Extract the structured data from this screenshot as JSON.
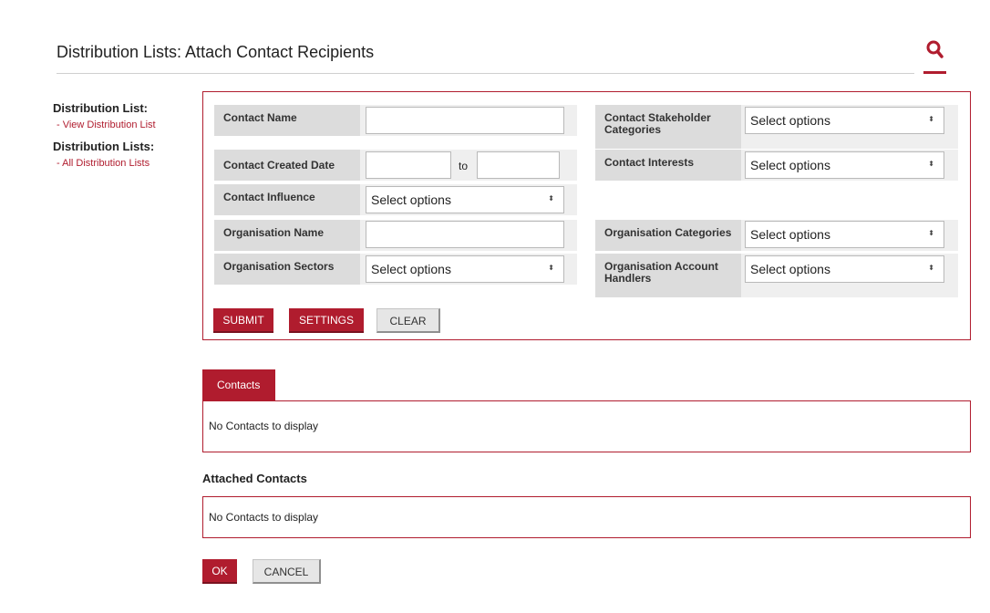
{
  "header": {
    "title": "Distribution Lists: Attach Contact Recipients",
    "search_icon": "search-icon",
    "accent_color": "#b01c2e"
  },
  "sidebar": {
    "section1_heading": "Distribution List:",
    "section1_link": "- View Distribution List",
    "section2_heading": "Distribution Lists:",
    "section2_link": "- All Distribution Lists"
  },
  "search_form": {
    "contact_name_label": "Contact Name",
    "contact_name_value": "",
    "stakeholder_label": "Contact Stakeholder Categories",
    "stakeholder_value": "Select options",
    "created_date_label": "Contact Created Date",
    "created_from_value": "",
    "created_to_label": "to",
    "created_to_value": "",
    "interests_label": "Contact Interests",
    "interests_value": "Select options",
    "influence_label": "Contact Influence",
    "influence_value": "Select options",
    "org_name_label": "Organisation Name",
    "org_name_value": "",
    "org_categories_label": "Organisation Categories",
    "org_categories_value": "Select options",
    "org_sectors_label": "Organisation Sectors",
    "org_sectors_value": "Select options",
    "org_handlers_label": "Organisation Account Handlers",
    "org_handlers_value": "Select options",
    "submit_label": "SUBMIT",
    "settings_label": "SETTINGS",
    "clear_label": "CLEAR"
  },
  "contacts": {
    "tab_label": "Contacts",
    "empty_text": "No Contacts to display"
  },
  "attached": {
    "heading": "Attached Contacts",
    "empty_text": "No Contacts to display"
  },
  "footer": {
    "ok_label": "OK",
    "cancel_label": "CANCEL"
  }
}
